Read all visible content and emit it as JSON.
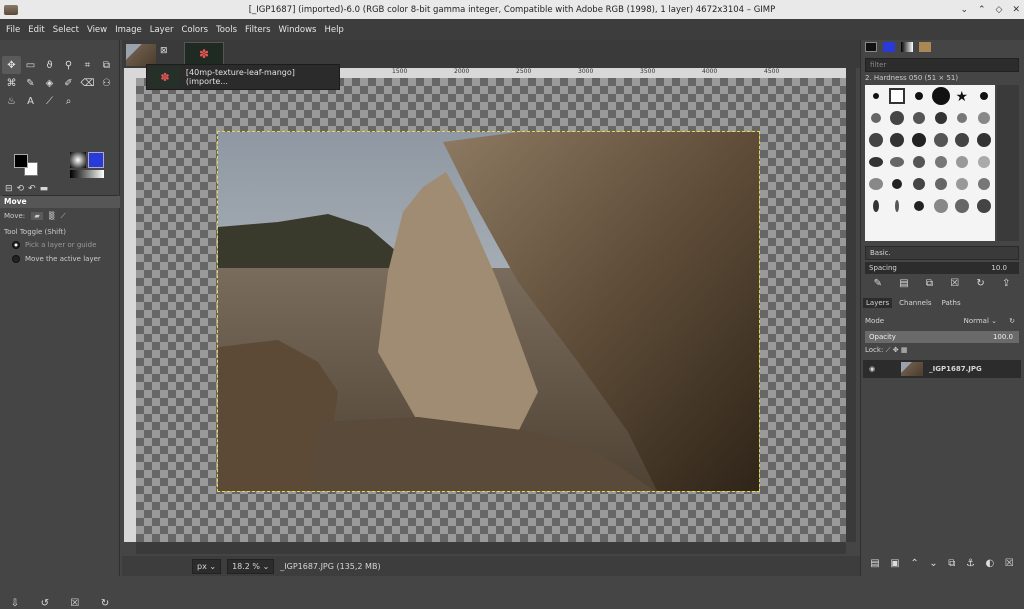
{
  "window": {
    "title": "[_IGP1687] (imported)-6.0 (RGB color 8-bit gamma integer, Compatible with Adobe RGB (1998), 1 layer) 4672x3104 – GIMP"
  },
  "menu": [
    "File",
    "Edit",
    "Select",
    "View",
    "Image",
    "Layer",
    "Colors",
    "Tools",
    "Filters",
    "Windows",
    "Help"
  ],
  "toolbox": {
    "section_title": "Move",
    "move_label": "Move:",
    "tool_toggle": "Tool Toggle  (Shift)",
    "option_pick": "Pick a layer or guide",
    "option_move": "Move the active layer"
  },
  "tooltip": {
    "text": "[40mp-texture-leaf-mango] (importe..."
  },
  "ruler": {
    "ticks": [
      "1500",
      "2000",
      "2500",
      "3000",
      "3500",
      "4000",
      "4500"
    ]
  },
  "status": {
    "unit": "px",
    "zoom": "18.2 %",
    "file": "_IGP1687.JPG (135,2 MB)"
  },
  "brushes": {
    "filter_placeholder": "filter",
    "label": "2. Hardness 050 (51 × 51)",
    "preset": "Basic.",
    "spacing_label": "Spacing",
    "spacing_value": "10.0"
  },
  "layers": {
    "tabs": [
      "Layers",
      "Channels",
      "Paths"
    ],
    "mode_label": "Mode",
    "mode_value": "Normal",
    "opacity_label": "Opacity",
    "opacity_value": "100.0",
    "lock_label": "Lock:",
    "layer_name": "_IGP1687.JPG"
  },
  "colors": {
    "accent": "#2a3ad8",
    "selection_border": "#e8d84a"
  }
}
